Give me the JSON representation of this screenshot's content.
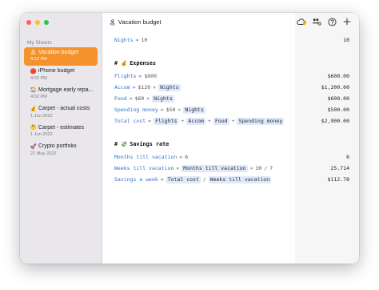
{
  "sidebar": {
    "heading": "My Sheets",
    "items": [
      {
        "emoji": "🏝",
        "title": "Vacation budget",
        "date": "4:12 PM",
        "active": true
      },
      {
        "emoji": "🔴",
        "title": "iPhone budget",
        "date": "4:02 PM",
        "active": false
      },
      {
        "emoji": "🏠",
        "title": "Mortgage early repa...",
        "date": "4:02 PM",
        "active": false
      },
      {
        "emoji": "💰",
        "title": "Carpet - actual costs",
        "date": "1 Jun 2022",
        "active": false
      },
      {
        "emoji": "🤔",
        "title": "Carpet - estimates",
        "date": "1 Jun 2022",
        "active": false
      },
      {
        "emoji": "🚀",
        "title": "Crypto portfolio",
        "date": "21 May 2022",
        "active": false
      }
    ]
  },
  "header": {
    "title": "Vacation budget",
    "title_icon": "palm-tree-icon",
    "icons": [
      "cloud-sync-icon",
      "people-settings-icon",
      "help-icon",
      "add-icon"
    ]
  },
  "document": {
    "nights": {
      "var": "Nights",
      "op": "=",
      "value": "10",
      "result": "10"
    },
    "expenses_heading": {
      "hash": "#",
      "emoji": "💰",
      "text": "Expenses"
    },
    "flights": {
      "var": "Flights",
      "op": "=",
      "value": "$600",
      "result": "$600.00"
    },
    "accom": {
      "var": "Accom",
      "op": "=",
      "value": "$120",
      "times": "×",
      "token": "Nights",
      "result": "$1,200.00"
    },
    "food": {
      "var": "Food",
      "op": "=",
      "value": "$60",
      "times": "×",
      "token": "Nights",
      "result": "$600.00"
    },
    "spending": {
      "var": "Spending money",
      "op": "=",
      "value": "$50",
      "times": "×",
      "token": "Nights",
      "result": "$500.00"
    },
    "total": {
      "var": "Total cost",
      "op": "=",
      "tokens": [
        "Flights",
        "Accom",
        "Food",
        "Spending money"
      ],
      "plus": "+",
      "result": "$2,900.00"
    },
    "savings_heading": {
      "hash": "#",
      "emoji": "💸",
      "text": "Savings rate"
    },
    "months": {
      "var": "Months till vacation",
      "op": "=",
      "value": "6",
      "result": "6"
    },
    "weeks": {
      "var": "Weeks till vacation",
      "op": "=",
      "token": "Months till vacation",
      "times": "×",
      "value": "30",
      "div": "/",
      "value2": "7",
      "result": "25.714"
    },
    "savings_week": {
      "var": "Savings a week",
      "op": "=",
      "token1": "Total cost",
      "div": "/",
      "token2": "Weeks till vacation",
      "result": "$112.78"
    }
  },
  "colors": {
    "accent": "#f4922b",
    "variable": "#2f74d0",
    "token_bg": "#dfe9f7"
  }
}
